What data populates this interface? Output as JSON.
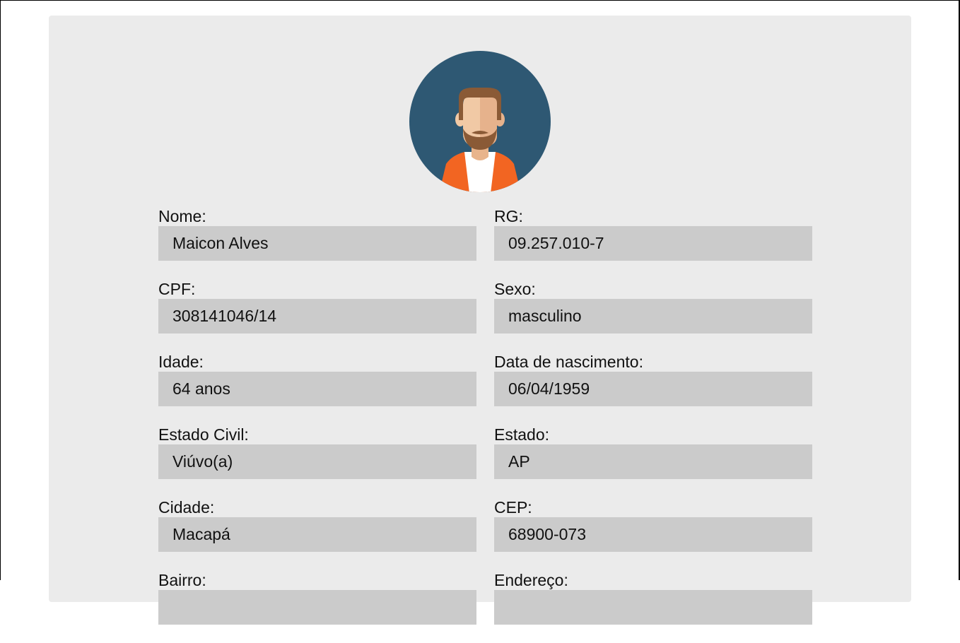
{
  "avatar": {
    "icon": "male-bearded-avatar-icon"
  },
  "fields": [
    {
      "label": "Nome:",
      "value": "Maicon Alves"
    },
    {
      "label": "RG:",
      "value": "09.257.010-7"
    },
    {
      "label": "CPF:",
      "value": "308141046/14"
    },
    {
      "label": "Sexo:",
      "value": "masculino"
    },
    {
      "label": "Idade:",
      "value": "64 anos"
    },
    {
      "label": "Data de nascimento:",
      "value": "06/04/1959"
    },
    {
      "label": "Estado Civil:",
      "value": "Viúvo(a)"
    },
    {
      "label": "Estado:",
      "value": "AP"
    },
    {
      "label": "Cidade:",
      "value": "Macapá"
    },
    {
      "label": "CEP:",
      "value": "68900-073"
    },
    {
      "label": "Bairro:",
      "value": ""
    },
    {
      "label": "Endereço:",
      "value": ""
    }
  ],
  "colors": {
    "card_bg": "#ebebeb",
    "field_bg": "#cbcbcb",
    "avatar_bg": "#2e5873",
    "jacket": "#f26522",
    "skin": "#f1c9a5",
    "hair": "#8a5a36"
  }
}
